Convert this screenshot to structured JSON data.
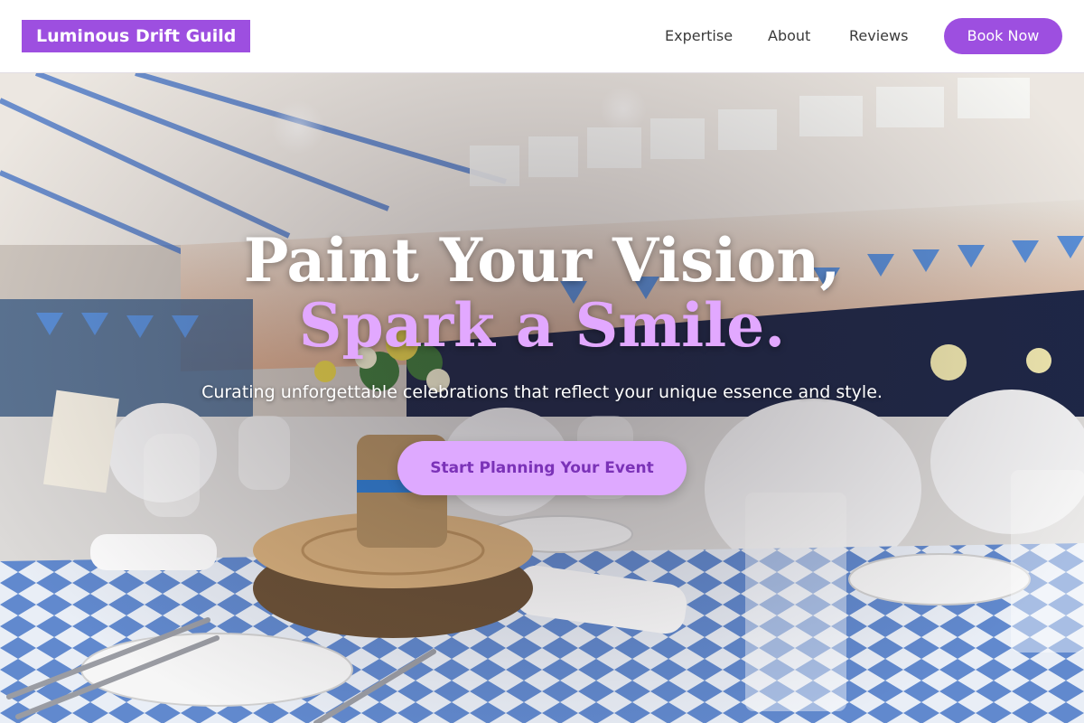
{
  "header": {
    "logo": "Luminous Drift Guild",
    "nav": [
      "Expertise",
      "About",
      "Reviews"
    ],
    "book_label": "Book Now"
  },
  "hero": {
    "headline_line1": "Paint Your Vision,",
    "headline_line2": "Spark a Smile.",
    "subtitle": "Curating unforgettable celebrations that reflect your unique essence and style.",
    "cta_label": "Start Planning Your Event"
  },
  "colors": {
    "accent_purple": "#9d4fe0",
    "accent_lilac": "#dea9ff",
    "headline_accent": "#e2a8ff"
  }
}
